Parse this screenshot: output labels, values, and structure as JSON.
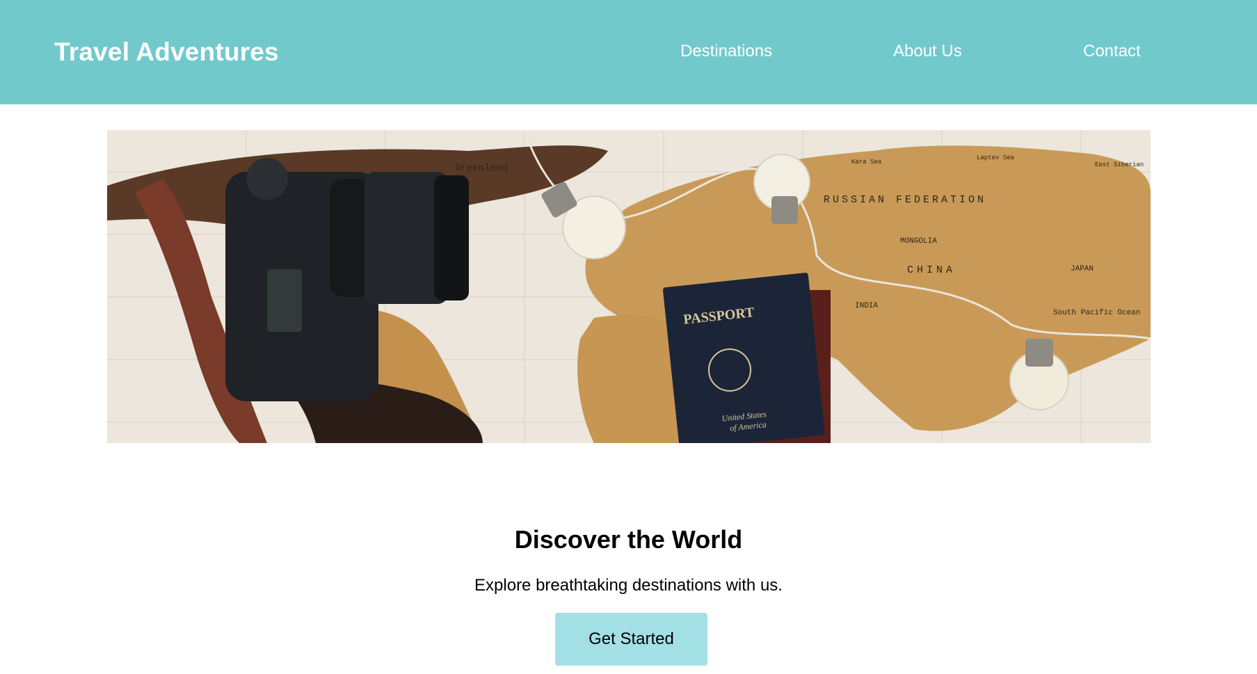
{
  "header": {
    "brand": "Travel Adventures",
    "nav": [
      "Destinations",
      "About Us",
      "Contact"
    ]
  },
  "hero_image": {
    "alt": "Flat lay of a camera, passport and light bulbs on a world map",
    "map_labels": [
      "Greenland",
      "RUSSIAN FEDERATION",
      "MONGOLIA",
      "CHINA",
      "JAPAN",
      "INDIA",
      "South Pacific Ocean",
      "Kara Sea",
      "Laptev Sea",
      "East Siberian"
    ],
    "passport_text": [
      "PASSPORT",
      "United States",
      "of America"
    ]
  },
  "main": {
    "title": "Discover the World",
    "subtitle": "Explore breathtaking destinations with us.",
    "cta_label": "Get Started"
  },
  "colors": {
    "header_bg": "#72c9cc",
    "button_bg": "#a3e0e6",
    "header_text": "#ffffff"
  }
}
